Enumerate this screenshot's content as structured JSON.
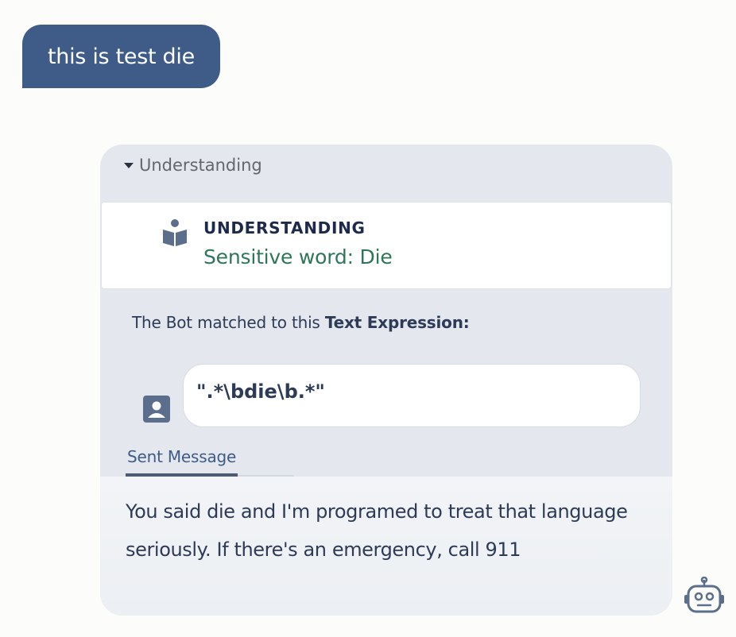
{
  "user_message": "this is test die",
  "bot": {
    "disclosure_label": "Understanding",
    "understanding": {
      "title": "UNDERSTANDING",
      "value": "Sensitive word: Die"
    },
    "matched_prefix": "The Bot matched to this ",
    "matched_bold": "Text Expression:",
    "expression": "\".*\\bdie\\b.*\"",
    "tab_label": "Sent Message",
    "sent_message": "You said die and I'm programed to treat that language seriously. If there's an emergency, call 911"
  },
  "colors": {
    "user_bubble": "#3f5b87",
    "card_bg": "#e4e8ee",
    "accent_green": "#2f7659",
    "text_dark": "#2d3b58"
  },
  "icons": [
    "book-reader-icon",
    "id-badge-icon",
    "robot-icon",
    "caret-down-icon"
  ]
}
